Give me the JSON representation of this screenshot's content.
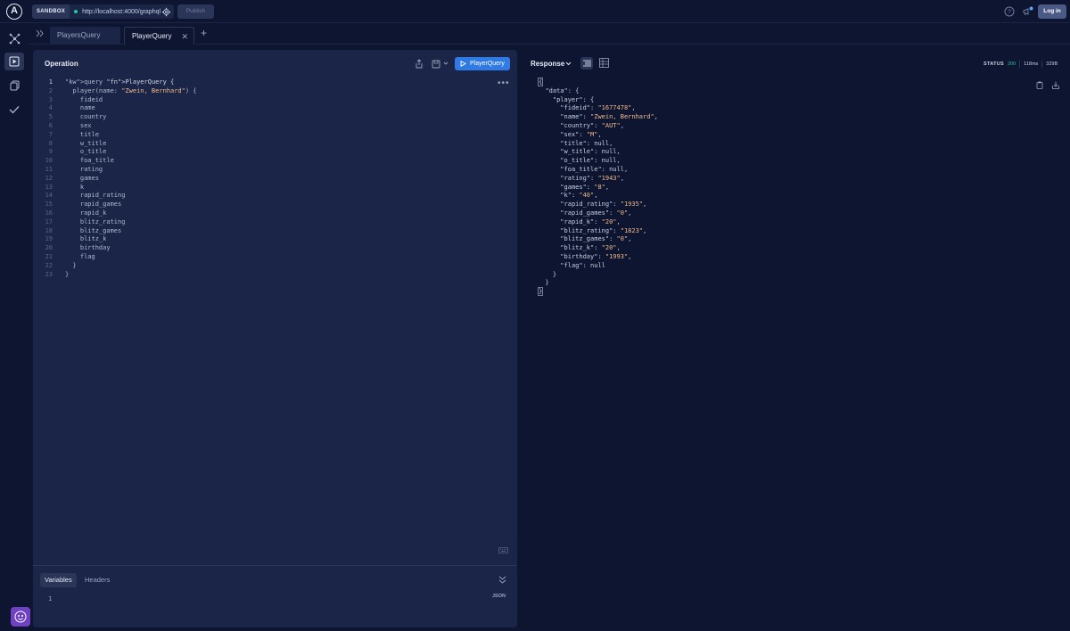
{
  "topbar": {
    "sandbox_label": "SANDBOX",
    "endpoint_url": "http://localhost:4000/graphql",
    "publish_label": "Publish",
    "login_label": "Log in"
  },
  "tabs": [
    {
      "label": "PlayersQuery",
      "active": false
    },
    {
      "label": "PlayerQuery",
      "active": true
    }
  ],
  "tab_close": "✕",
  "add_tab": "+",
  "operation": {
    "title": "Operation",
    "run_label": "PlayerQuery",
    "more": "•••",
    "lines": [
      "query PlayerQuery {",
      "  player(name: \"Zwein, Bernhard\") {",
      "    fideid",
      "    name",
      "    country",
      "    sex",
      "    title",
      "    w_title",
      "    o_title",
      "    foa_title",
      "    rating",
      "    games",
      "    k",
      "    rapid_rating",
      "    rapid_games",
      "    rapid_k",
      "    blitz_rating",
      "    blitz_games",
      "    blitz_k",
      "    birthday",
      "    flag",
      "  }",
      "}"
    ]
  },
  "variables": {
    "tab_variables": "Variables",
    "tab_headers": "Headers",
    "format_label": "JSON",
    "line_number": "1"
  },
  "response": {
    "title": "Response",
    "status_label": "STATUS",
    "status_code": "200",
    "time": "118ms",
    "size": "329B",
    "fields": [
      {
        "key": "fideid",
        "value": "\"1677478\""
      },
      {
        "key": "name",
        "value": "\"Zwein, Bernhard\""
      },
      {
        "key": "country",
        "value": "\"AUT\""
      },
      {
        "key": "sex",
        "value": "\"M\""
      },
      {
        "key": "title",
        "value": "null"
      },
      {
        "key": "w_title",
        "value": "null"
      },
      {
        "key": "o_title",
        "value": "null"
      },
      {
        "key": "foa_title",
        "value": "null"
      },
      {
        "key": "rating",
        "value": "\"1943\""
      },
      {
        "key": "games",
        "value": "\"8\""
      },
      {
        "key": "k",
        "value": "\"40\""
      },
      {
        "key": "rapid_rating",
        "value": "\"1935\""
      },
      {
        "key": "rapid_games",
        "value": "\"0\""
      },
      {
        "key": "rapid_k",
        "value": "\"20\""
      },
      {
        "key": "blitz_rating",
        "value": "\"1823\""
      },
      {
        "key": "blitz_games",
        "value": "\"0\""
      },
      {
        "key": "blitz_k",
        "value": "\"20\""
      },
      {
        "key": "birthday",
        "value": "\"1993\""
      },
      {
        "key": "flag",
        "value": "null"
      }
    ]
  },
  "colors": {
    "accent": "#2f7ae5",
    "status_ok": "#20c997",
    "background": "#0d1530",
    "panel": "#1b2547"
  },
  "icons": [
    "apollo-logo-icon",
    "gear-icon",
    "help-icon",
    "announcement-icon",
    "schema-graph-icon",
    "explorer-play-icon",
    "documents-icon",
    "checks-icon",
    "collapse-icon",
    "share-icon",
    "save-icon",
    "play-icon",
    "keyboard-icon",
    "chevron-down-icon",
    "text-view-icon",
    "table-view-icon",
    "copy-icon",
    "download-icon"
  ]
}
